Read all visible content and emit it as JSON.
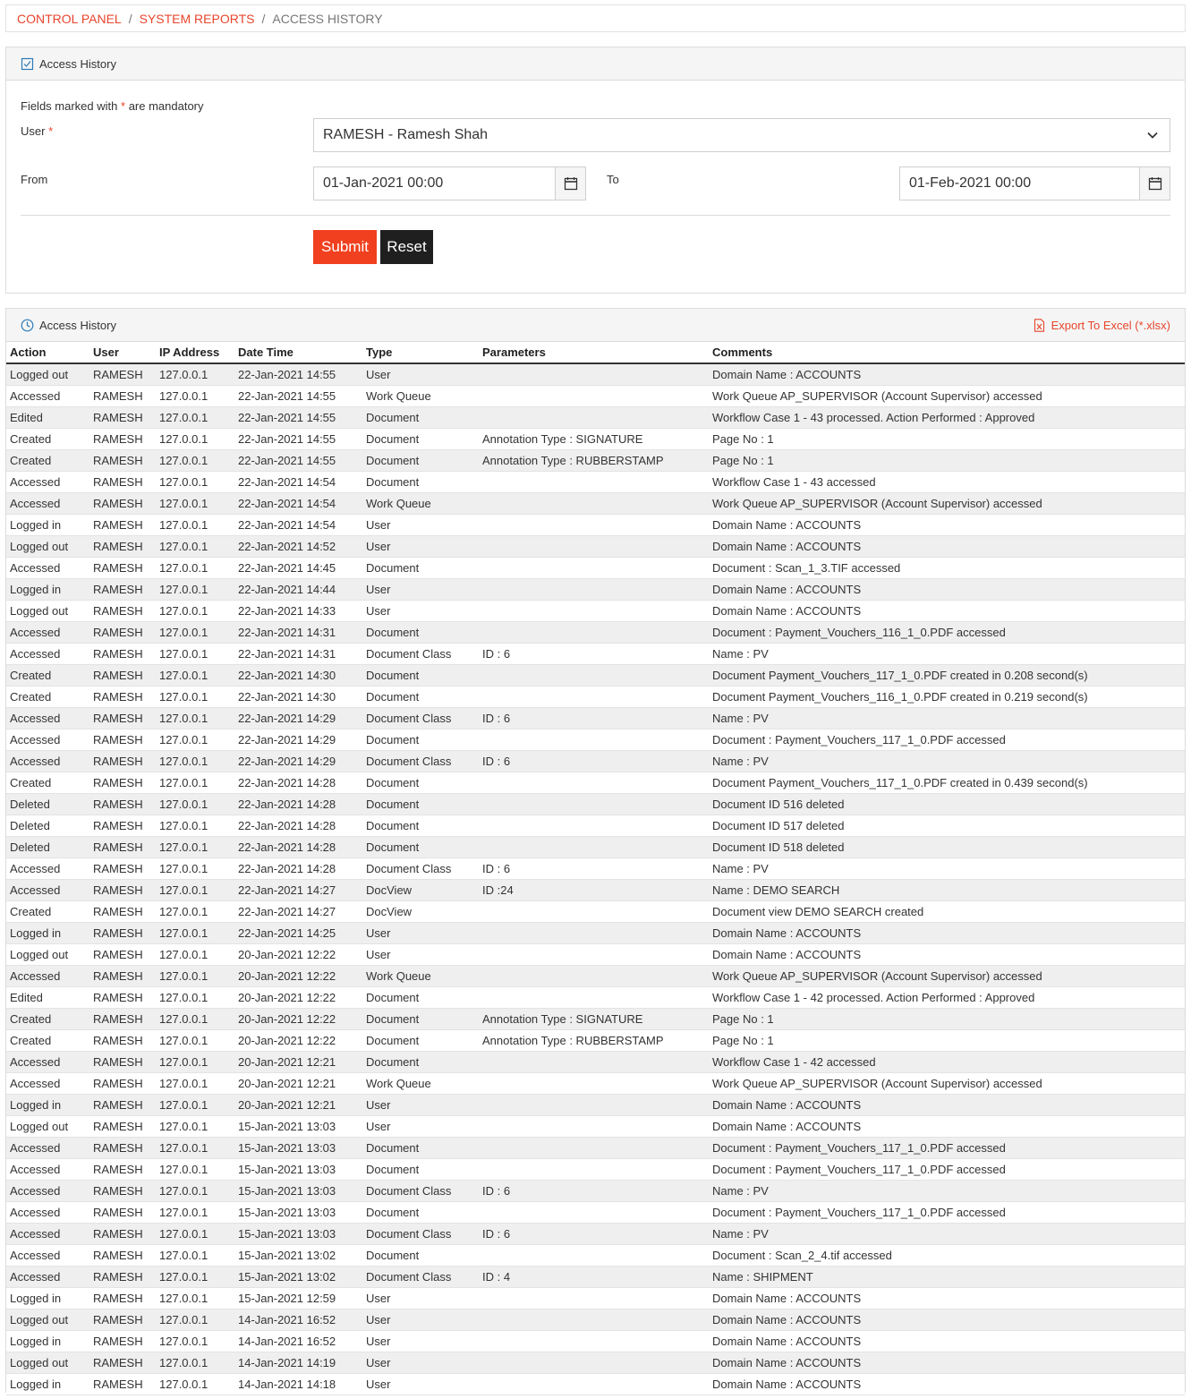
{
  "breadcrumb": {
    "items": [
      "CONTROL PANEL",
      "SYSTEM REPORTS",
      "ACCESS HISTORY"
    ],
    "separator": "/"
  },
  "form": {
    "title": "Access History",
    "mandatory_prefix": "Fields marked with",
    "mandatory_star": "*",
    "mandatory_suffix": "are mandatory",
    "user_label": "User",
    "user_value": "RAMESH - Ramesh Shah",
    "from_label": "From",
    "from_value": "01-Jan-2021 00:00",
    "to_label": "To",
    "to_value": "01-Feb-2021 00:00",
    "submit_label": "Submit",
    "reset_label": "Reset"
  },
  "history": {
    "title": "Access History",
    "export_label": "Export To Excel (*.xlsx)",
    "columns": [
      "Action",
      "User",
      "IP Address",
      "Date Time",
      "Type",
      "Parameters",
      "Comments"
    ],
    "rows": [
      [
        "Logged out",
        "RAMESH",
        "127.0.0.1",
        "22-Jan-2021 14:55",
        "User",
        "",
        "Domain Name : ACCOUNTS"
      ],
      [
        "Accessed",
        "RAMESH",
        "127.0.0.1",
        "22-Jan-2021 14:55",
        "Work Queue",
        "",
        "Work Queue AP_SUPERVISOR (Account Supervisor) accessed"
      ],
      [
        "Edited",
        "RAMESH",
        "127.0.0.1",
        "22-Jan-2021 14:55",
        "Document",
        "",
        "Workflow Case 1 - 43 processed. Action Performed : Approved"
      ],
      [
        "Created",
        "RAMESH",
        "127.0.0.1",
        "22-Jan-2021 14:55",
        "Document",
        "Annotation Type : SIGNATURE",
        "Page No : 1"
      ],
      [
        "Created",
        "RAMESH",
        "127.0.0.1",
        "22-Jan-2021 14:55",
        "Document",
        "Annotation Type : RUBBERSTAMP",
        "Page No : 1"
      ],
      [
        "Accessed",
        "RAMESH",
        "127.0.0.1",
        "22-Jan-2021 14:54",
        "Document",
        "",
        "Workflow Case 1 - 43 accessed"
      ],
      [
        "Accessed",
        "RAMESH",
        "127.0.0.1",
        "22-Jan-2021 14:54",
        "Work Queue",
        "",
        "Work Queue AP_SUPERVISOR (Account Supervisor) accessed"
      ],
      [
        "Logged in",
        "RAMESH",
        "127.0.0.1",
        "22-Jan-2021 14:54",
        "User",
        "",
        "Domain Name : ACCOUNTS"
      ],
      [
        "Logged out",
        "RAMESH",
        "127.0.0.1",
        "22-Jan-2021 14:52",
        "User",
        "",
        "Domain Name : ACCOUNTS"
      ],
      [
        "Accessed",
        "RAMESH",
        "127.0.0.1",
        "22-Jan-2021 14:45",
        "Document",
        "",
        "Document : Scan_1_3.TIF accessed"
      ],
      [
        "Logged in",
        "RAMESH",
        "127.0.0.1",
        "22-Jan-2021 14:44",
        "User",
        "",
        "Domain Name : ACCOUNTS"
      ],
      [
        "Logged out",
        "RAMESH",
        "127.0.0.1",
        "22-Jan-2021 14:33",
        "User",
        "",
        "Domain Name : ACCOUNTS"
      ],
      [
        "Accessed",
        "RAMESH",
        "127.0.0.1",
        "22-Jan-2021 14:31",
        "Document",
        "",
        "Document : Payment_Vouchers_116_1_0.PDF accessed"
      ],
      [
        "Accessed",
        "RAMESH",
        "127.0.0.1",
        "22-Jan-2021 14:31",
        "Document Class",
        "ID : 6",
        "Name : PV"
      ],
      [
        "Created",
        "RAMESH",
        "127.0.0.1",
        "22-Jan-2021 14:30",
        "Document",
        "",
        "Document Payment_Vouchers_117_1_0.PDF created in 0.208 second(s)"
      ],
      [
        "Created",
        "RAMESH",
        "127.0.0.1",
        "22-Jan-2021 14:30",
        "Document",
        "",
        "Document Payment_Vouchers_116_1_0.PDF created in 0.219 second(s)"
      ],
      [
        "Accessed",
        "RAMESH",
        "127.0.0.1",
        "22-Jan-2021 14:29",
        "Document Class",
        "ID : 6",
        "Name : PV"
      ],
      [
        "Accessed",
        "RAMESH",
        "127.0.0.1",
        "22-Jan-2021 14:29",
        "Document",
        "",
        "Document : Payment_Vouchers_117_1_0.PDF accessed"
      ],
      [
        "Accessed",
        "RAMESH",
        "127.0.0.1",
        "22-Jan-2021 14:29",
        "Document Class",
        "ID : 6",
        "Name : PV"
      ],
      [
        "Created",
        "RAMESH",
        "127.0.0.1",
        "22-Jan-2021 14:28",
        "Document",
        "",
        "Document Payment_Vouchers_117_1_0.PDF created in 0.439 second(s)"
      ],
      [
        "Deleted",
        "RAMESH",
        "127.0.0.1",
        "22-Jan-2021 14:28",
        "Document",
        "",
        "Document ID 516 deleted"
      ],
      [
        "Deleted",
        "RAMESH",
        "127.0.0.1",
        "22-Jan-2021 14:28",
        "Document",
        "",
        "Document ID 517 deleted"
      ],
      [
        "Deleted",
        "RAMESH",
        "127.0.0.1",
        "22-Jan-2021 14:28",
        "Document",
        "",
        "Document ID 518 deleted"
      ],
      [
        "Accessed",
        "RAMESH",
        "127.0.0.1",
        "22-Jan-2021 14:28",
        "Document Class",
        "ID : 6",
        "Name : PV"
      ],
      [
        "Accessed",
        "RAMESH",
        "127.0.0.1",
        "22-Jan-2021 14:27",
        "DocView",
        "ID :24",
        "Name : DEMO SEARCH"
      ],
      [
        "Created",
        "RAMESH",
        "127.0.0.1",
        "22-Jan-2021 14:27",
        "DocView",
        "",
        "Document view DEMO SEARCH created"
      ],
      [
        "Logged in",
        "RAMESH",
        "127.0.0.1",
        "22-Jan-2021 14:25",
        "User",
        "",
        "Domain Name : ACCOUNTS"
      ],
      [
        "Logged out",
        "RAMESH",
        "127.0.0.1",
        "20-Jan-2021 12:22",
        "User",
        "",
        "Domain Name : ACCOUNTS"
      ],
      [
        "Accessed",
        "RAMESH",
        "127.0.0.1",
        "20-Jan-2021 12:22",
        "Work Queue",
        "",
        "Work Queue AP_SUPERVISOR (Account Supervisor) accessed"
      ],
      [
        "Edited",
        "RAMESH",
        "127.0.0.1",
        "20-Jan-2021 12:22",
        "Document",
        "",
        "Workflow Case 1 - 42 processed. Action Performed : Approved"
      ],
      [
        "Created",
        "RAMESH",
        "127.0.0.1",
        "20-Jan-2021 12:22",
        "Document",
        "Annotation Type : SIGNATURE",
        "Page No : 1"
      ],
      [
        "Created",
        "RAMESH",
        "127.0.0.1",
        "20-Jan-2021 12:22",
        "Document",
        "Annotation Type : RUBBERSTAMP",
        "Page No : 1"
      ],
      [
        "Accessed",
        "RAMESH",
        "127.0.0.1",
        "20-Jan-2021 12:21",
        "Document",
        "",
        "Workflow Case 1 - 42 accessed"
      ],
      [
        "Accessed",
        "RAMESH",
        "127.0.0.1",
        "20-Jan-2021 12:21",
        "Work Queue",
        "",
        "Work Queue AP_SUPERVISOR (Account Supervisor) accessed"
      ],
      [
        "Logged in",
        "RAMESH",
        "127.0.0.1",
        "20-Jan-2021 12:21",
        "User",
        "",
        "Domain Name : ACCOUNTS"
      ],
      [
        "Logged out",
        "RAMESH",
        "127.0.0.1",
        "15-Jan-2021 13:03",
        "User",
        "",
        "Domain Name : ACCOUNTS"
      ],
      [
        "Accessed",
        "RAMESH",
        "127.0.0.1",
        "15-Jan-2021 13:03",
        "Document",
        "",
        "Document : Payment_Vouchers_117_1_0.PDF accessed"
      ],
      [
        "Accessed",
        "RAMESH",
        "127.0.0.1",
        "15-Jan-2021 13:03",
        "Document",
        "",
        "Document : Payment_Vouchers_117_1_0.PDF accessed"
      ],
      [
        "Accessed",
        "RAMESH",
        "127.0.0.1",
        "15-Jan-2021 13:03",
        "Document Class",
        "ID : 6",
        "Name : PV"
      ],
      [
        "Accessed",
        "RAMESH",
        "127.0.0.1",
        "15-Jan-2021 13:03",
        "Document",
        "",
        "Document : Payment_Vouchers_117_1_0.PDF accessed"
      ],
      [
        "Accessed",
        "RAMESH",
        "127.0.0.1",
        "15-Jan-2021 13:03",
        "Document Class",
        "ID : 6",
        "Name : PV"
      ],
      [
        "Accessed",
        "RAMESH",
        "127.0.0.1",
        "15-Jan-2021 13:02",
        "Document",
        "",
        "Document : Scan_2_4.tif accessed"
      ],
      [
        "Accessed",
        "RAMESH",
        "127.0.0.1",
        "15-Jan-2021 13:02",
        "Document Class",
        "ID : 4",
        "Name : SHIPMENT"
      ],
      [
        "Logged in",
        "RAMESH",
        "127.0.0.1",
        "15-Jan-2021 12:59",
        "User",
        "",
        "Domain Name : ACCOUNTS"
      ],
      [
        "Logged out",
        "RAMESH",
        "127.0.0.1",
        "14-Jan-2021 16:52",
        "User",
        "",
        "Domain Name : ACCOUNTS"
      ],
      [
        "Logged in",
        "RAMESH",
        "127.0.0.1",
        "14-Jan-2021 16:52",
        "User",
        "",
        "Domain Name : ACCOUNTS"
      ],
      [
        "Logged out",
        "RAMESH",
        "127.0.0.1",
        "14-Jan-2021 14:19",
        "User",
        "",
        "Domain Name : ACCOUNTS"
      ],
      [
        "Logged in",
        "RAMESH",
        "127.0.0.1",
        "14-Jan-2021 14:18",
        "User",
        "",
        "Domain Name : ACCOUNTS"
      ]
    ]
  },
  "colors": {
    "accent": "#e8452c",
    "submit_bg": "#f0401f",
    "reset_bg": "#1f1f1f",
    "row_alt": "#efefef"
  },
  "icons": {
    "form_header": "checklist-icon",
    "history_header": "clock-icon",
    "export": "excel-file-icon",
    "select": "chevron-down-icon",
    "date": "calendar-icon"
  }
}
